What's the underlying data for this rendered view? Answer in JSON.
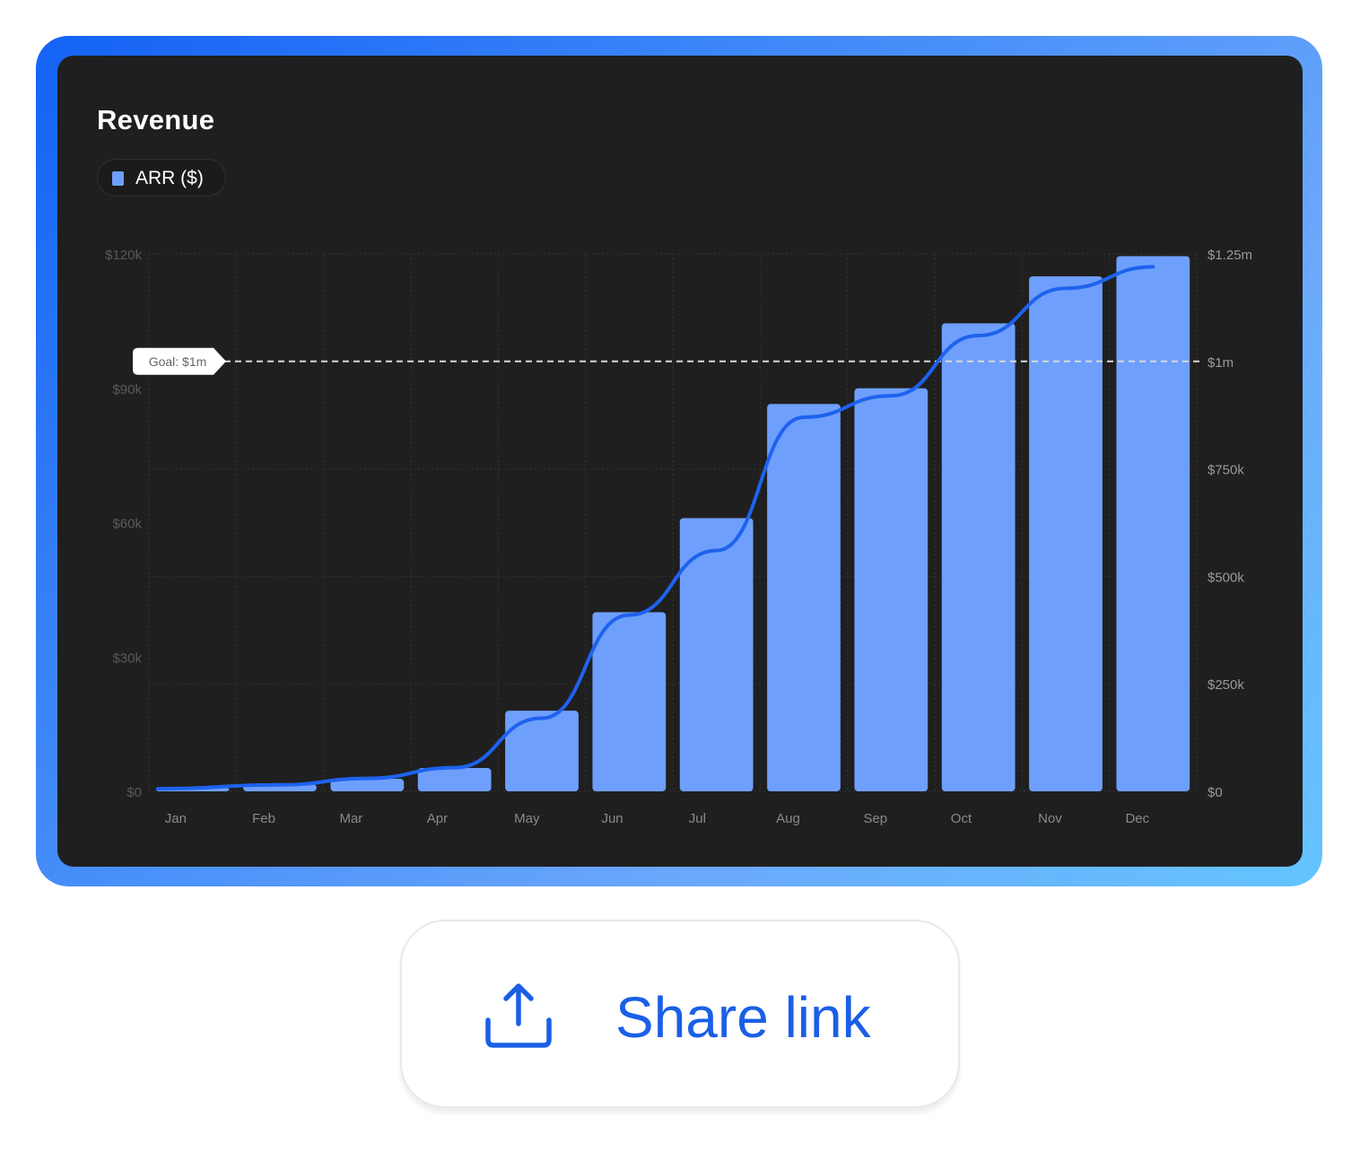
{
  "chart_data": {
    "type": "bar",
    "title": "Revenue",
    "legend": [
      {
        "label": "ARR ($)",
        "color": "#6e9ffc"
      }
    ],
    "categories": [
      "Jan",
      "Feb",
      "Mar",
      "Apr",
      "May",
      "Jun",
      "Jul",
      "Aug",
      "Sep",
      "Oct",
      "Nov",
      "Dec"
    ],
    "series": [
      {
        "name": "ARR ($)",
        "axis": "left",
        "chart_type": "bar",
        "color": "#6e9ffc",
        "values": [
          800,
          1600,
          2800,
          5200,
          18000,
          40000,
          61000,
          86500,
          90000,
          104500,
          115000,
          119500
        ]
      },
      {
        "axis": "right",
        "chart_type": "line",
        "color": "#1e62ee",
        "values": [
          6000,
          15000,
          30000,
          55000,
          170000,
          410000,
          560000,
          870000,
          920000,
          1060000,
          1170000,
          1220000
        ]
      }
    ],
    "y_left": {
      "min": 0,
      "max": 120000,
      "ticks": [
        0,
        30000,
        60000,
        90000,
        120000
      ],
      "tick_labels": [
        "$0",
        "$30k",
        "$60k",
        "$90k",
        "$120k"
      ]
    },
    "y_right": {
      "min": 0,
      "max": 1250000,
      "ticks": [
        0,
        250000,
        500000,
        750000,
        1000000,
        1250000
      ],
      "tick_labels": [
        "$0",
        "$250k",
        "$500k",
        "$750k",
        "$1m",
        "$1.25m"
      ]
    },
    "goal": {
      "value": 1000000,
      "axis": "right",
      "label": "Goal: $1m"
    },
    "grid": true,
    "legend_position": "top-left"
  },
  "share_button": {
    "label": "Share link",
    "icon": "upload-icon"
  }
}
